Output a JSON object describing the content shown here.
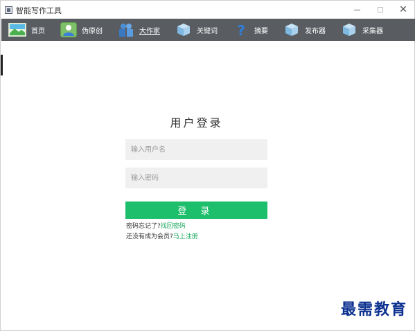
{
  "window": {
    "title": "智能写作工具",
    "controls": {
      "minimize": "—",
      "maximize": "□",
      "close": "✕"
    }
  },
  "toolbar": {
    "items": [
      {
        "label": "首页",
        "icon": "home-icon"
      },
      {
        "label": "伪原创",
        "icon": "person-icon"
      },
      {
        "label": "大作家",
        "icon": "people-icon"
      },
      {
        "label": "关键词",
        "icon": "box-icon"
      },
      {
        "label": "摘要",
        "icon": "question-icon"
      },
      {
        "label": "发布器",
        "icon": "box-icon"
      },
      {
        "label": "采集器",
        "icon": "box-icon"
      }
    ]
  },
  "login": {
    "title": "用户登录",
    "username_placeholder": "输入用户名",
    "password_placeholder": "输入密码",
    "submit_label": "登 录",
    "forgot_text": "密码忘记了?",
    "forgot_link": "找回密码",
    "register_text": "还没有成为会员?",
    "register_link": "马上注册"
  },
  "watermark": {
    "text": "最需教育"
  },
  "colors": {
    "toolbar_bg": "#595c61",
    "accent_green": "#1dbe6c",
    "link_green": "#18a85c",
    "input_bg": "#f0f0f0",
    "watermark_blue": "#0a2f8f"
  }
}
